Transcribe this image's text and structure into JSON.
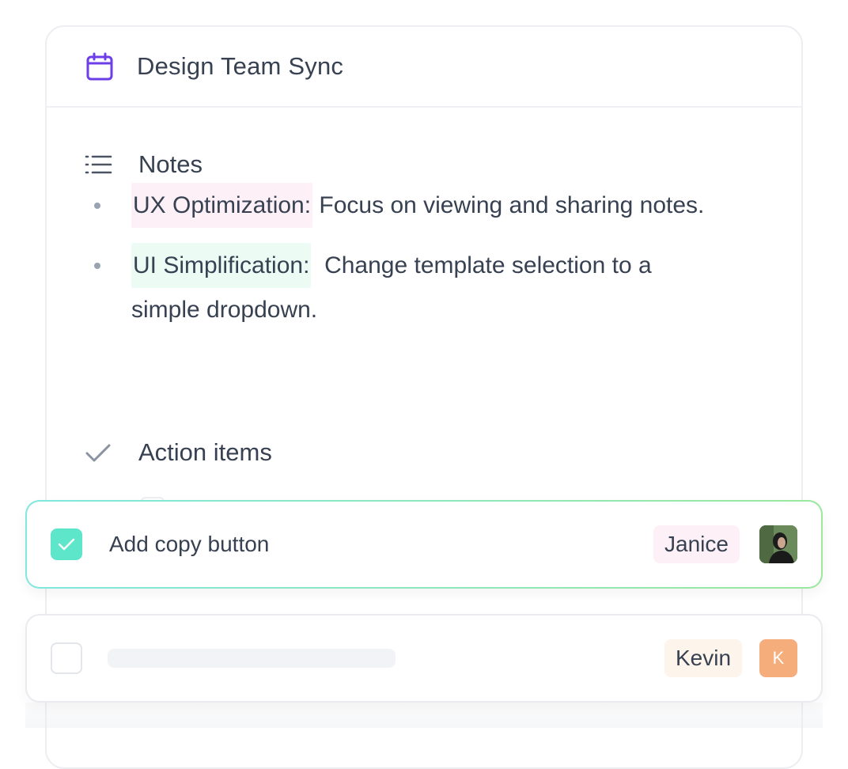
{
  "meeting": {
    "title": "Design Team Sync",
    "icon": "calendar-icon"
  },
  "notes": {
    "heading": "Notes",
    "icon": "list-icon",
    "items": [
      {
        "highlight": "UX Optimization:",
        "text": " Focus on viewing and sharing notes."
      },
      {
        "highlight": "UI Simplification:",
        "text": "  Change template selection to a simple dropdown."
      }
    ]
  },
  "action_items": {
    "heading": "Action items",
    "icon": "check-icon",
    "tasks": [
      {
        "text": "Add copy button",
        "done": true,
        "assignee": "Janice",
        "avatar": "photo"
      },
      {
        "text": "",
        "done": false,
        "assignee": "Kevin",
        "avatar_initial": "K"
      }
    ]
  },
  "colors": {
    "accent": "#6d3ee8",
    "checkbox_checked": "#5ee6cb",
    "highlight_pink": "#fdf0f6",
    "highlight_green": "#edfbf5",
    "avatar_k": "#f6ad7c"
  }
}
